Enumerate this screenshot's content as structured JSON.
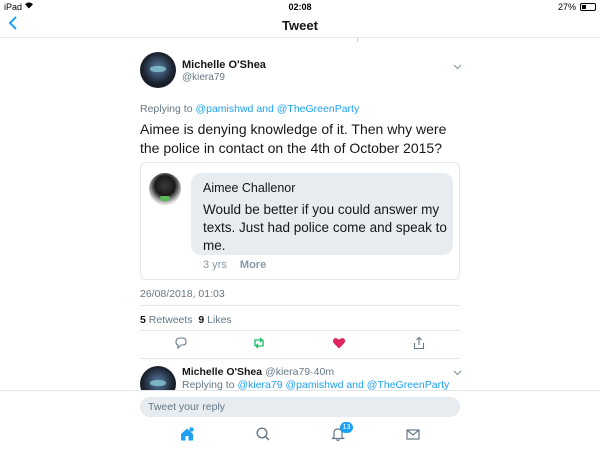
{
  "status_bar": {
    "device": "iPad",
    "time": "02:08",
    "battery": "27%"
  },
  "nav": {
    "title": "Tweet",
    "back_icon": "chevron-left-icon"
  },
  "tweet": {
    "author_name": "Michelle O'Shea",
    "author_handle": "@kiera79",
    "replying_prefix": "Replying to",
    "replying_user1": "@pamishwd",
    "replying_and": "and",
    "replying_user2": "@TheGreenParty",
    "text": "Aimee is denying knowledge of it. Then why were the police in contact on the 4th of October 2015?",
    "quote": {
      "sender": "Aimee Challenor",
      "message": "Would be better if you could answer my texts. Just had police come and speak to me.",
      "age": "3 yrs",
      "more": "More"
    },
    "timestamp": "26/08/2018, 01:03",
    "retweets_count": "5",
    "retweets_label": "Retweets",
    "likes_count": "9",
    "likes_label": "Likes",
    "liked": true
  },
  "reply": {
    "author_name": "Michelle O'Shea",
    "author_handle": "@kiera79",
    "time_sep": "·",
    "time": "40m",
    "replying_prefix": "Replying to",
    "user1": "@kiera79",
    "user2": "@pamishwd",
    "and": "and",
    "user3": "@TheGreenParty"
  },
  "compose": {
    "placeholder": "Tweet your reply"
  },
  "tabs": {
    "notifications_badge": "13"
  },
  "colors": {
    "accent": "#1da1f2",
    "like": "#e0245e",
    "retweet": "#17bf63",
    "muted": "#657786"
  }
}
